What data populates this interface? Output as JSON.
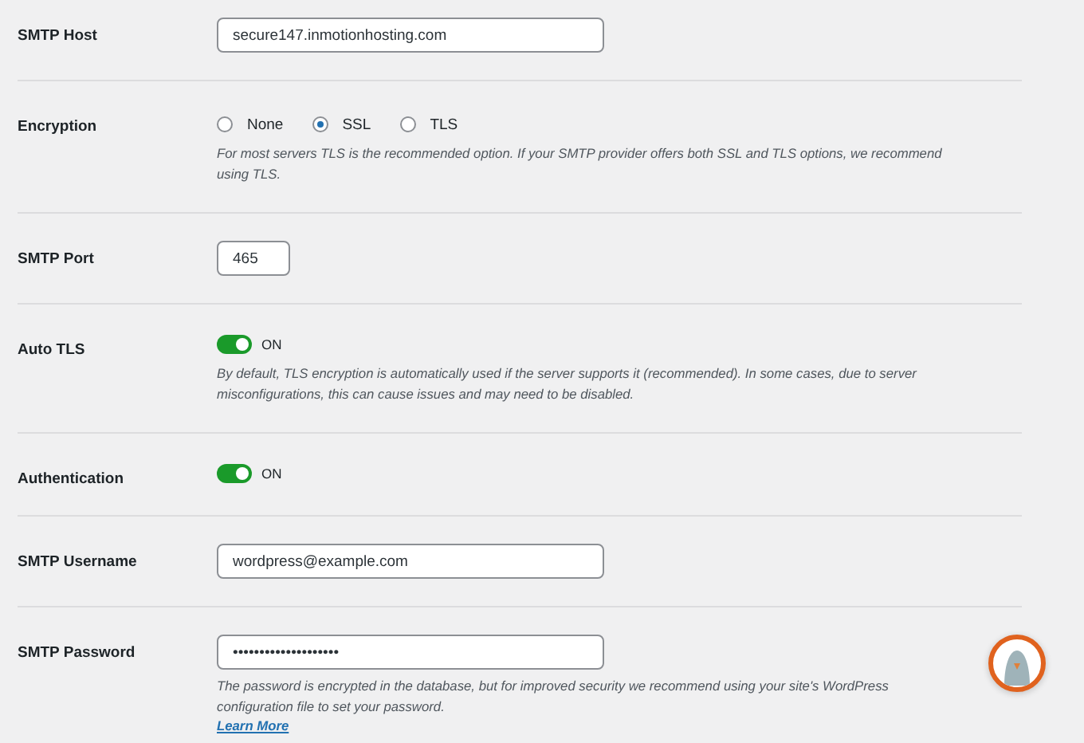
{
  "rows": [
    {
      "kind": "text",
      "label": "SMTP Host",
      "value": "secure147.inmotionhosting.com"
    },
    {
      "kind": "radio",
      "label": "Encryption",
      "options": [
        {
          "label": "None",
          "selected": false
        },
        {
          "label": "SSL",
          "selected": true
        },
        {
          "label": "TLS",
          "selected": false
        }
      ],
      "description": "For most servers TLS is the recommended option. If your SMTP provider offers both SSL and TLS options, we recommend using TLS."
    },
    {
      "kind": "number",
      "label": "SMTP Port",
      "value": "465"
    },
    {
      "kind": "toggle",
      "label": "Auto TLS",
      "on": true,
      "state_label": "ON",
      "description": "By default, TLS encryption is automatically used if the server supports it (recommended). In some cases, due to server misconfigurations, this can cause issues and may need to be disabled."
    },
    {
      "kind": "toggle",
      "label": "Authentication",
      "on": true,
      "state_label": "ON"
    },
    {
      "kind": "text",
      "label": "SMTP Username",
      "value": "wordpress@example.com"
    },
    {
      "kind": "text",
      "label": "SMTP Password",
      "value": "••••••••••••••••••••",
      "description": "The password is encrypted in the database, but for improved security we recommend using your site's WordPress configuration file to set your password.",
      "link": "Learn More"
    }
  ]
}
